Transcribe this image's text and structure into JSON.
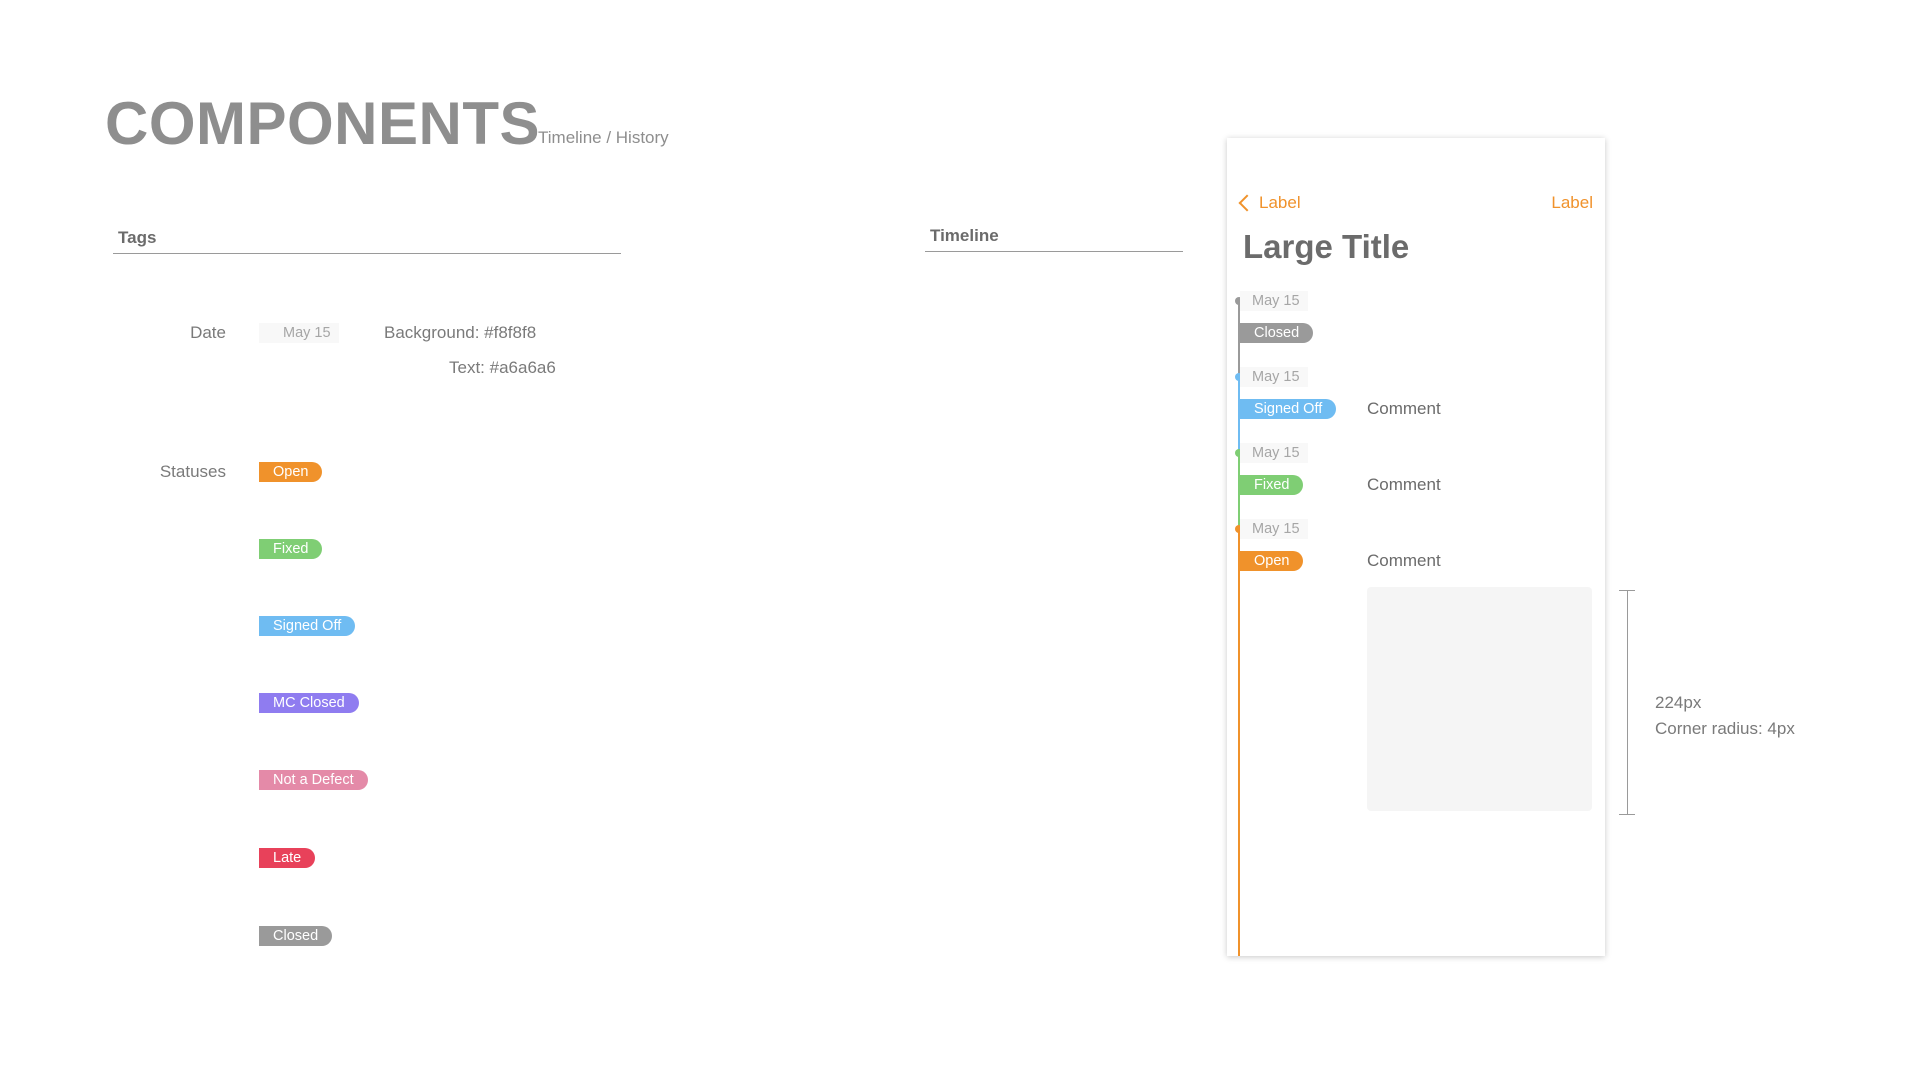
{
  "header": {
    "title": "COMPONENTS",
    "subtitle": "Timeline / History"
  },
  "tags_section": {
    "heading": "Tags",
    "date_row": {
      "label": "Date",
      "chip": "May 15",
      "background_note": "Background: #f8f8f8",
      "text_note": "Text: #a6a6a6"
    },
    "statuses_label": "Statuses",
    "statuses": [
      {
        "label": "Open",
        "color": "#f0922b"
      },
      {
        "label": "Fixed",
        "color": "#7fce74"
      },
      {
        "label": "Signed Off",
        "color": "#6fbcf2"
      },
      {
        "label": "MC Closed",
        "color": "#8f7cf0"
      },
      {
        "label": "Not a Defect",
        "color": "#e48aa8"
      },
      {
        "label": "Late",
        "color": "#e8415a"
      },
      {
        "label": "Closed",
        "color": "#9a9a9a"
      }
    ]
  },
  "timeline_section": {
    "heading": "Timeline"
  },
  "phone": {
    "back_label": "Label",
    "right_label": "Label",
    "large_title": "Large Title",
    "entries": [
      {
        "date": "May 15",
        "status": "Closed",
        "color": "#9a9a9a",
        "comment": ""
      },
      {
        "date": "May 15",
        "status": "Signed Off",
        "color": "#6fbcf2",
        "comment": "Comment"
      },
      {
        "date": "May 15",
        "status": "Fixed",
        "color": "#7fce74",
        "comment": "Comment"
      },
      {
        "date": "May 15",
        "status": "Open",
        "color": "#f0922b",
        "comment": "Comment"
      }
    ]
  },
  "measurement": {
    "size": "224px",
    "radius": "Corner radius: 4px"
  },
  "colors": {
    "accent": "#f0922b",
    "date_bg": "#f8f8f8",
    "date_text": "#a6a6a6"
  }
}
